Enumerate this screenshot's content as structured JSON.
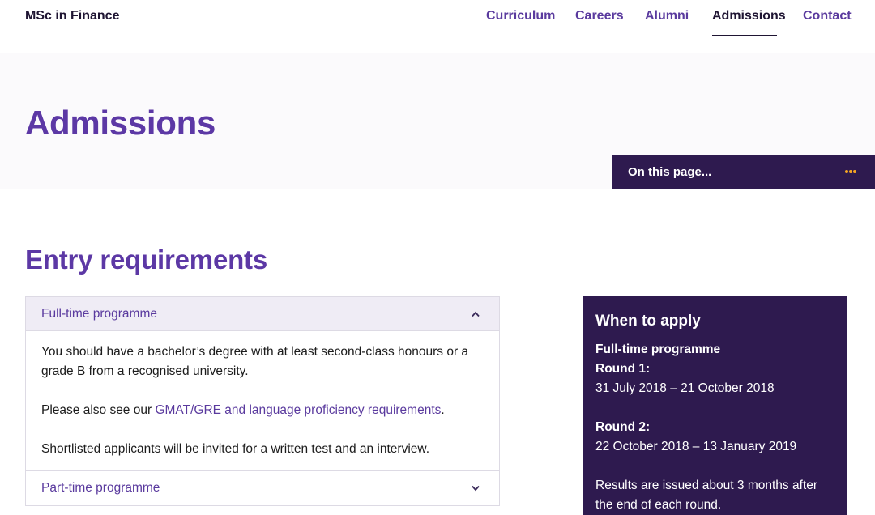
{
  "header": {
    "brand": "MSc in Finance",
    "nav": [
      {
        "label": "Curriculum",
        "active": false
      },
      {
        "label": "Careers",
        "active": false
      },
      {
        "label": "Alumni",
        "active": false
      },
      {
        "label": "Admissions",
        "active": true
      },
      {
        "label": "Contact",
        "active": false
      }
    ]
  },
  "hero": {
    "title": "Admissions",
    "on_this_page": "On this page...",
    "menu_icon": "dots-icon"
  },
  "section": {
    "title": "Entry requirements"
  },
  "accordion": {
    "items": [
      {
        "title": "Full-time programme",
        "expanded": true,
        "icon": "chevron-up-icon",
        "body": {
          "p1": "You should have a bachelor’s degree with at least second-class honours or a grade B from a recognised university.",
          "p2_prefix": "Please also see our ",
          "p2_link": "GMAT/GRE and language proficiency requirements",
          "p2_suffix": ".",
          "p3": "Shortlisted applicants will be invited for a written test and an interview."
        }
      },
      {
        "title": "Part-time programme",
        "expanded": false,
        "icon": "chevron-down-icon"
      }
    ]
  },
  "apply": {
    "title": "When to apply",
    "subhead": "Full-time programme",
    "round1_label": "Round 1:",
    "round1_dates": "31 July 2018 – 21 October 2018",
    "round2_label": "Round 2:",
    "round2_dates": "22 October 2018 – 13 January 2019",
    "results_note": "Results are issued about 3 months after the end of each round."
  },
  "colors": {
    "accent_purple": "#5c38a5",
    "dark_purple": "#2e1a4f",
    "orange": "#f5a623"
  }
}
